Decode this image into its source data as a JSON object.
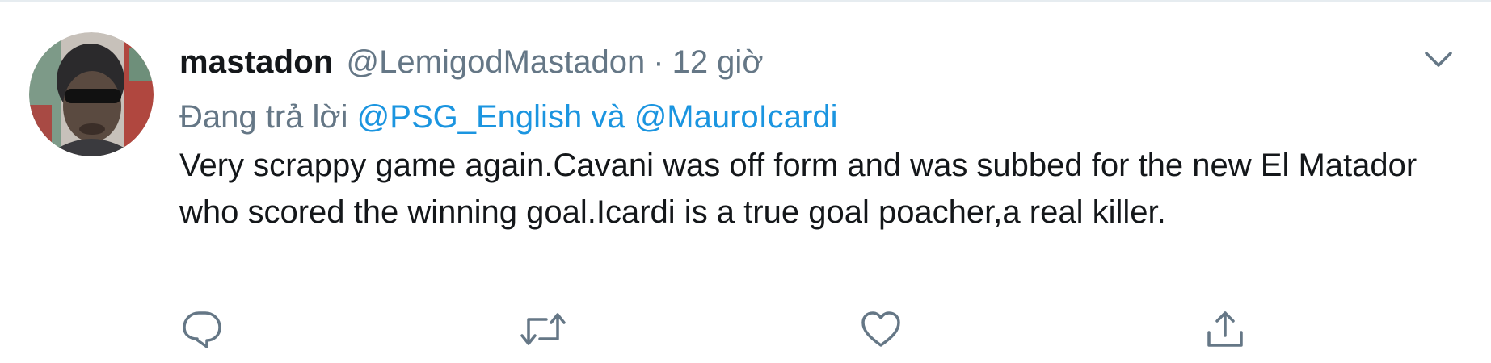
{
  "tweet": {
    "author": {
      "display_name": "mastadon",
      "handle": "@LemigodMastadon",
      "avatar_icon": "user-avatar-photo"
    },
    "separator": "·",
    "time": "12 giờ",
    "reply": {
      "prefix": "Đang trả lời",
      "mentions": [
        "@PSG_English",
        "@MauroIcardi"
      ],
      "conjunction": "và"
    },
    "text": "Very scrappy game again.Cavani was off form and was subbed for the new El Matador who scored the winning goal.Icardi is a true goal poacher,a real killer.",
    "menu_icon": "chevron-down-icon",
    "actions": {
      "reply_icon": "reply-icon",
      "retweet_icon": "retweet-icon",
      "like_icon": "heart-icon",
      "share_icon": "share-icon"
    },
    "colors": {
      "link": "#1b95e0",
      "secondary_text": "#657786",
      "primary_text": "#14171a",
      "icon": "#657786",
      "border": "#e6ecf0"
    }
  }
}
